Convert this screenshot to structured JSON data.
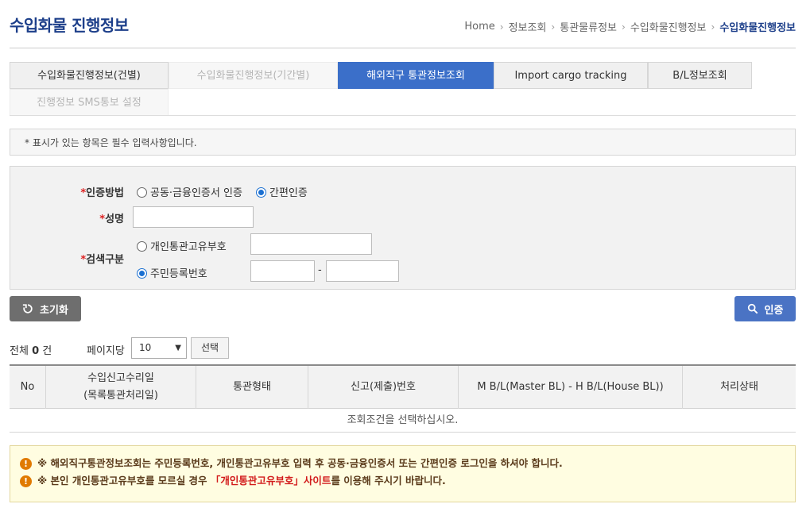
{
  "header": {
    "title": "수입화물 진행정보",
    "breadcrumb": [
      "Home",
      "정보조회",
      "통관물류정보",
      "수입화물진행정보",
      "수입화물진행정보"
    ]
  },
  "tabs": [
    {
      "label": "수입화물진행정보(건별)",
      "state": "normal"
    },
    {
      "label": "수입화물진행정보(기간별)",
      "state": "disabled"
    },
    {
      "label": "해외직구 통관정보조회",
      "state": "active"
    },
    {
      "label": "Import cargo tracking",
      "state": "normal"
    },
    {
      "label": "B/L정보조회",
      "state": "normal"
    },
    {
      "label": "진행정보 SMS통보 설정",
      "state": "disabled"
    }
  ],
  "notice": "* 표시가 있는 항목은 필수 입력사항입니다.",
  "form": {
    "auth_method": {
      "label": "인증방법",
      "options": [
        {
          "label": "공동·금융인증서 인증",
          "checked": false
        },
        {
          "label": "간편인증",
          "checked": true
        }
      ]
    },
    "name": {
      "label": "성명",
      "value": ""
    },
    "search_type": {
      "label": "검색구분",
      "options": [
        {
          "label": "개인통관고유부호",
          "checked": false
        },
        {
          "label": "주민등록번호",
          "checked": true
        }
      ],
      "rrn_separator": "-"
    }
  },
  "buttons": {
    "reset": "초기화",
    "auth": "인증",
    "select": "선택"
  },
  "list": {
    "total_label": "전체",
    "total_count": "0",
    "total_unit": "건",
    "per_page_label": "페이지당",
    "per_page_value": "10",
    "headers": [
      "No",
      "수입신고수리일\n(목록통관처리일)",
      "통관형태",
      "신고(제출)번호",
      "M B/L(Master BL) - H B/L(House BL))",
      "처리상태"
    ],
    "empty_message": "조회조건을 선택하십시오."
  },
  "warnings": {
    "line1": "※ 해외직구통관정보조회는 주민등록번호, 개인통관고유부호 입력 후 공동·금융인증서 또는 간편인증 로그인을 하셔야 합니다.",
    "line2_prefix": "※ 본인 개인통관고유부호를 모르실 경우",
    "line2_link": "「개인통관고유부호」사이트",
    "line2_suffix": "를 이용해 주시기 바랍니다."
  },
  "colors": {
    "accent": "#3b6fc9",
    "title": "#1d3f8a",
    "required": "#dd2222",
    "warning_icon": "#e07a00"
  }
}
